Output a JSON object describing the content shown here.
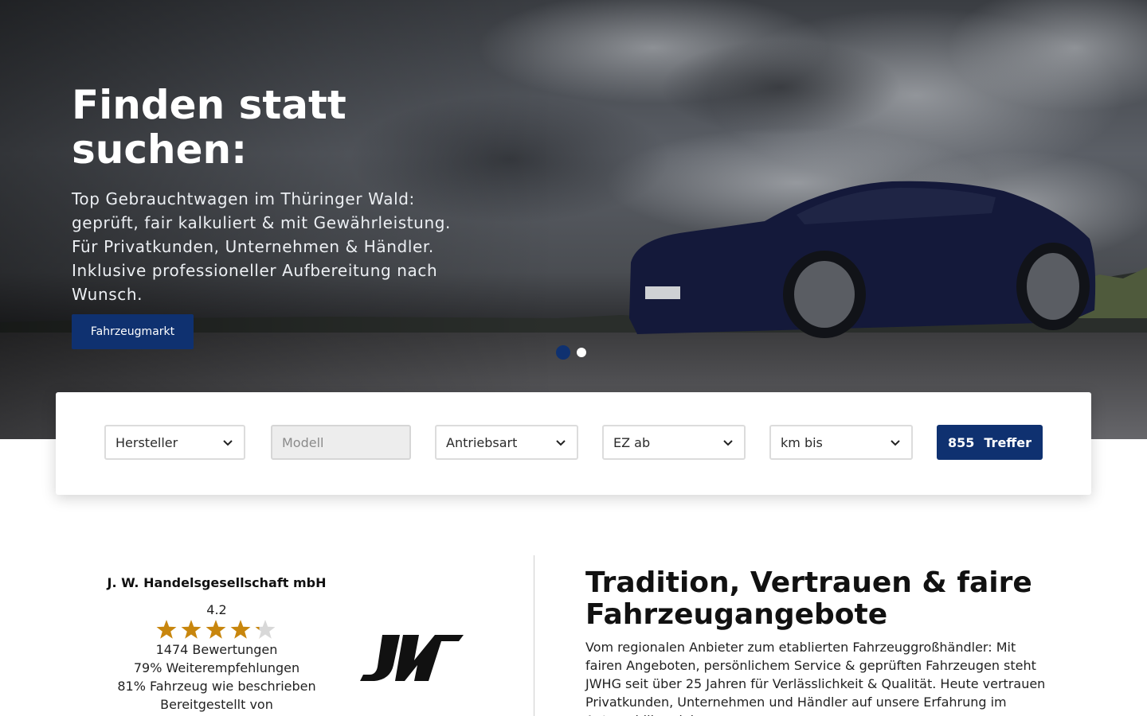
{
  "hero": {
    "title": "Finden statt suchen:",
    "subtitle": "Top Gebrauchtwagen im Thüringer Wald: geprüft, fair kalkuliert & mit Gewährleistung. Für Privatkunden, Unternehmen & Händler. Inklusive professioneller Aufbereitung nach Wunsch.",
    "cta_label": "Fahrzeugmarkt",
    "slides": {
      "count": 2,
      "active": 1
    }
  },
  "search": {
    "manufacturer": "Hersteller",
    "model": "Modell",
    "drive_type": "Antriebsart",
    "registration_from": "EZ ab",
    "mileage_to": "km bis",
    "hits_count": "855",
    "hits_label": "Treffer"
  },
  "reviews": {
    "company": "J. W. Handelsgesellschaft mbH",
    "rating": "4.2",
    "rating_value": 4.2,
    "count_text": "1474 Bewertungen",
    "recommend_text": "79% Weiterempfehlungen",
    "as_described_text": "81% Fahrzeug wie beschrieben",
    "provided_by": "Bereitgestellt von"
  },
  "about": {
    "title": "Tradition, Vertrauen & faire Fahrzeugangebote",
    "text": "Vom regionalen Anbieter zum etablierten Fahrzeuggroßhändler: Mit fairen Angeboten, persönlichem Service & geprüften Fahrzeugen steht JWHG seit über 25 Jahren für Verlässlichkeit & Qualität. Heute vertrauen Privatkunden, Unternehmen und Händler auf unsere Erfahrung im Automobilhandel."
  },
  "colors": {
    "brand": "#0f3170",
    "star": "#c8860d",
    "star_empty": "#d8d8d8"
  },
  "icons": {
    "select_chevron": "chevron-down-icon",
    "rating": "star-icon",
    "logo": "jw-logo"
  }
}
